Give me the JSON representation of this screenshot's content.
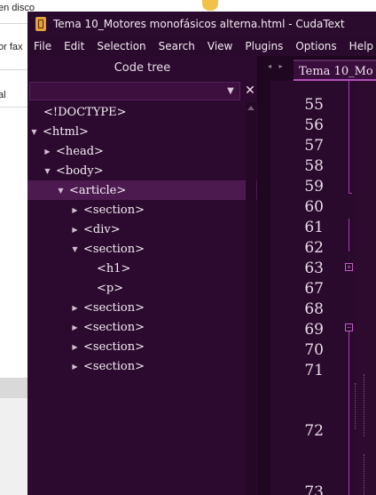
{
  "background_app": {
    "line1": "en disco",
    "line2": "or fax",
    "line3": "al"
  },
  "window": {
    "title": "Tema 10_Motores monofásicos alterna.html - CudaText",
    "icon": "cudatext-app-icon"
  },
  "menu": [
    "File",
    "Edit",
    "Selection",
    "Search",
    "View",
    "Plugins",
    "Options",
    "Help",
    "="
  ],
  "code_tree": {
    "title": "Code tree",
    "filter_value": "",
    "dropdown_icon": "chevron-down-icon",
    "clear_icon": "close-icon",
    "nodes": [
      {
        "label": "<!DOCTYPE>",
        "state": "leaf"
      },
      {
        "label": "<html>",
        "state": "expanded"
      },
      {
        "label": "<head>",
        "state": "collapsed"
      },
      {
        "label": "<body>",
        "state": "expanded"
      },
      {
        "label": "<article>",
        "state": "expanded",
        "selected": true
      },
      {
        "label": "<section>",
        "state": "collapsed"
      },
      {
        "label": "<div>",
        "state": "collapsed"
      },
      {
        "label": "<section>",
        "state": "expanded"
      },
      {
        "label": "<h1>",
        "state": "leaf"
      },
      {
        "label": "<p>",
        "state": "leaf"
      },
      {
        "label": "<section>",
        "state": "collapsed"
      },
      {
        "label": "<section>",
        "state": "collapsed"
      },
      {
        "label": "<section>",
        "state": "collapsed"
      },
      {
        "label": "<section>",
        "state": "collapsed"
      }
    ]
  },
  "editor": {
    "tab_label": "Tema 10_Mo",
    "tab_nav": "◂ ▸",
    "line_numbers": [
      "55",
      "56",
      "57",
      "58",
      "59",
      "60",
      "61",
      "62",
      "63",
      "67",
      "68",
      "69",
      "70",
      "71",
      "72",
      "73"
    ],
    "fold_markers": [
      {
        "line": "63",
        "symbol": "+"
      },
      {
        "line": "69",
        "symbol": "−"
      }
    ]
  },
  "colors": {
    "background": "#2a0a2c",
    "selection": "#4c1a4f",
    "accent": "#b04fb6",
    "text": "#f4ecf4"
  }
}
